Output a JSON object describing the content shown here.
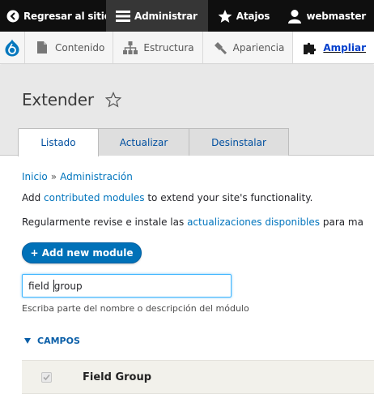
{
  "toolbar": {
    "back_label": "Regresar al sitio",
    "admin_label": "Administrar",
    "shortcuts_label": "Atajos",
    "user_label": "webmaster"
  },
  "tray": {
    "items": [
      {
        "label": "Contenido",
        "icon": "file-icon"
      },
      {
        "label": "Estructura",
        "icon": "sitemap-icon"
      },
      {
        "label": "Apariencia",
        "icon": "brush-icon"
      },
      {
        "label": "Ampliar",
        "icon": "puzzle-icon"
      }
    ]
  },
  "page": {
    "title": "Extender"
  },
  "tabs": [
    {
      "label": "Listado"
    },
    {
      "label": "Actualizar"
    },
    {
      "label": "Desinstalar"
    }
  ],
  "breadcrumb": {
    "home": "Inicio",
    "separator": "»",
    "admin": "Administración"
  },
  "intro": {
    "p1_before": "Add ",
    "p1_link": "contributed modules",
    "p1_after": " to extend your site's functionality.",
    "p2_before": "Regularmente revise e instale las ",
    "p2_link": "actualizaciones disponibles",
    "p2_after": " para ma"
  },
  "add_button": {
    "label": "+ Add new module"
  },
  "filter": {
    "value_before_caret": "field ",
    "value_after_caret": "group",
    "description": "Escriba parte del nombre o descripción del módulo"
  },
  "group": {
    "label": "CAMPOS"
  },
  "modules": [
    {
      "name": "Field Group",
      "enabled": true
    }
  ],
  "colors": {
    "toolbar_bg": "#0f0f0f",
    "link": "#0074bd",
    "primary_button": "#0071b8"
  }
}
